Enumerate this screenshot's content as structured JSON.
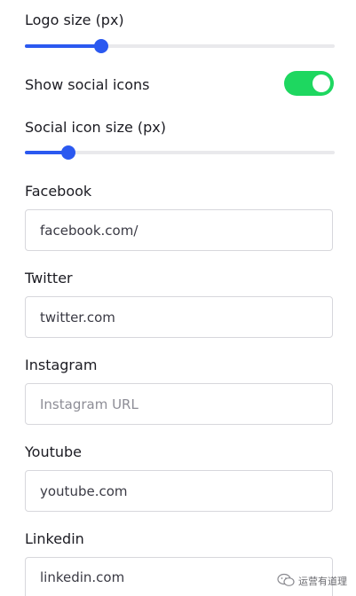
{
  "logo_size": {
    "label": "Logo size (px)",
    "value_fraction": 0.245
  },
  "show_social": {
    "label": "Show social icons",
    "enabled": true,
    "color_on": "#1ed760"
  },
  "social_icon_size": {
    "label": "Social icon size (px)",
    "value_fraction": 0.14
  },
  "slider_color": "#2b59f0",
  "fields": {
    "facebook": {
      "label": "Facebook",
      "value": "facebook.com/",
      "placeholder": ""
    },
    "twitter": {
      "label": "Twitter",
      "value": "twitter.com",
      "placeholder": ""
    },
    "instagram": {
      "label": "Instagram",
      "value": "",
      "placeholder": "Instagram URL"
    },
    "youtube": {
      "label": "Youtube",
      "value": "youtube.com",
      "placeholder": ""
    },
    "linkedin": {
      "label": "Linkedin",
      "value": "linkedin.com",
      "placeholder": ""
    }
  },
  "watermark": {
    "icon": "wechat-icon",
    "text": "运营有道理"
  }
}
